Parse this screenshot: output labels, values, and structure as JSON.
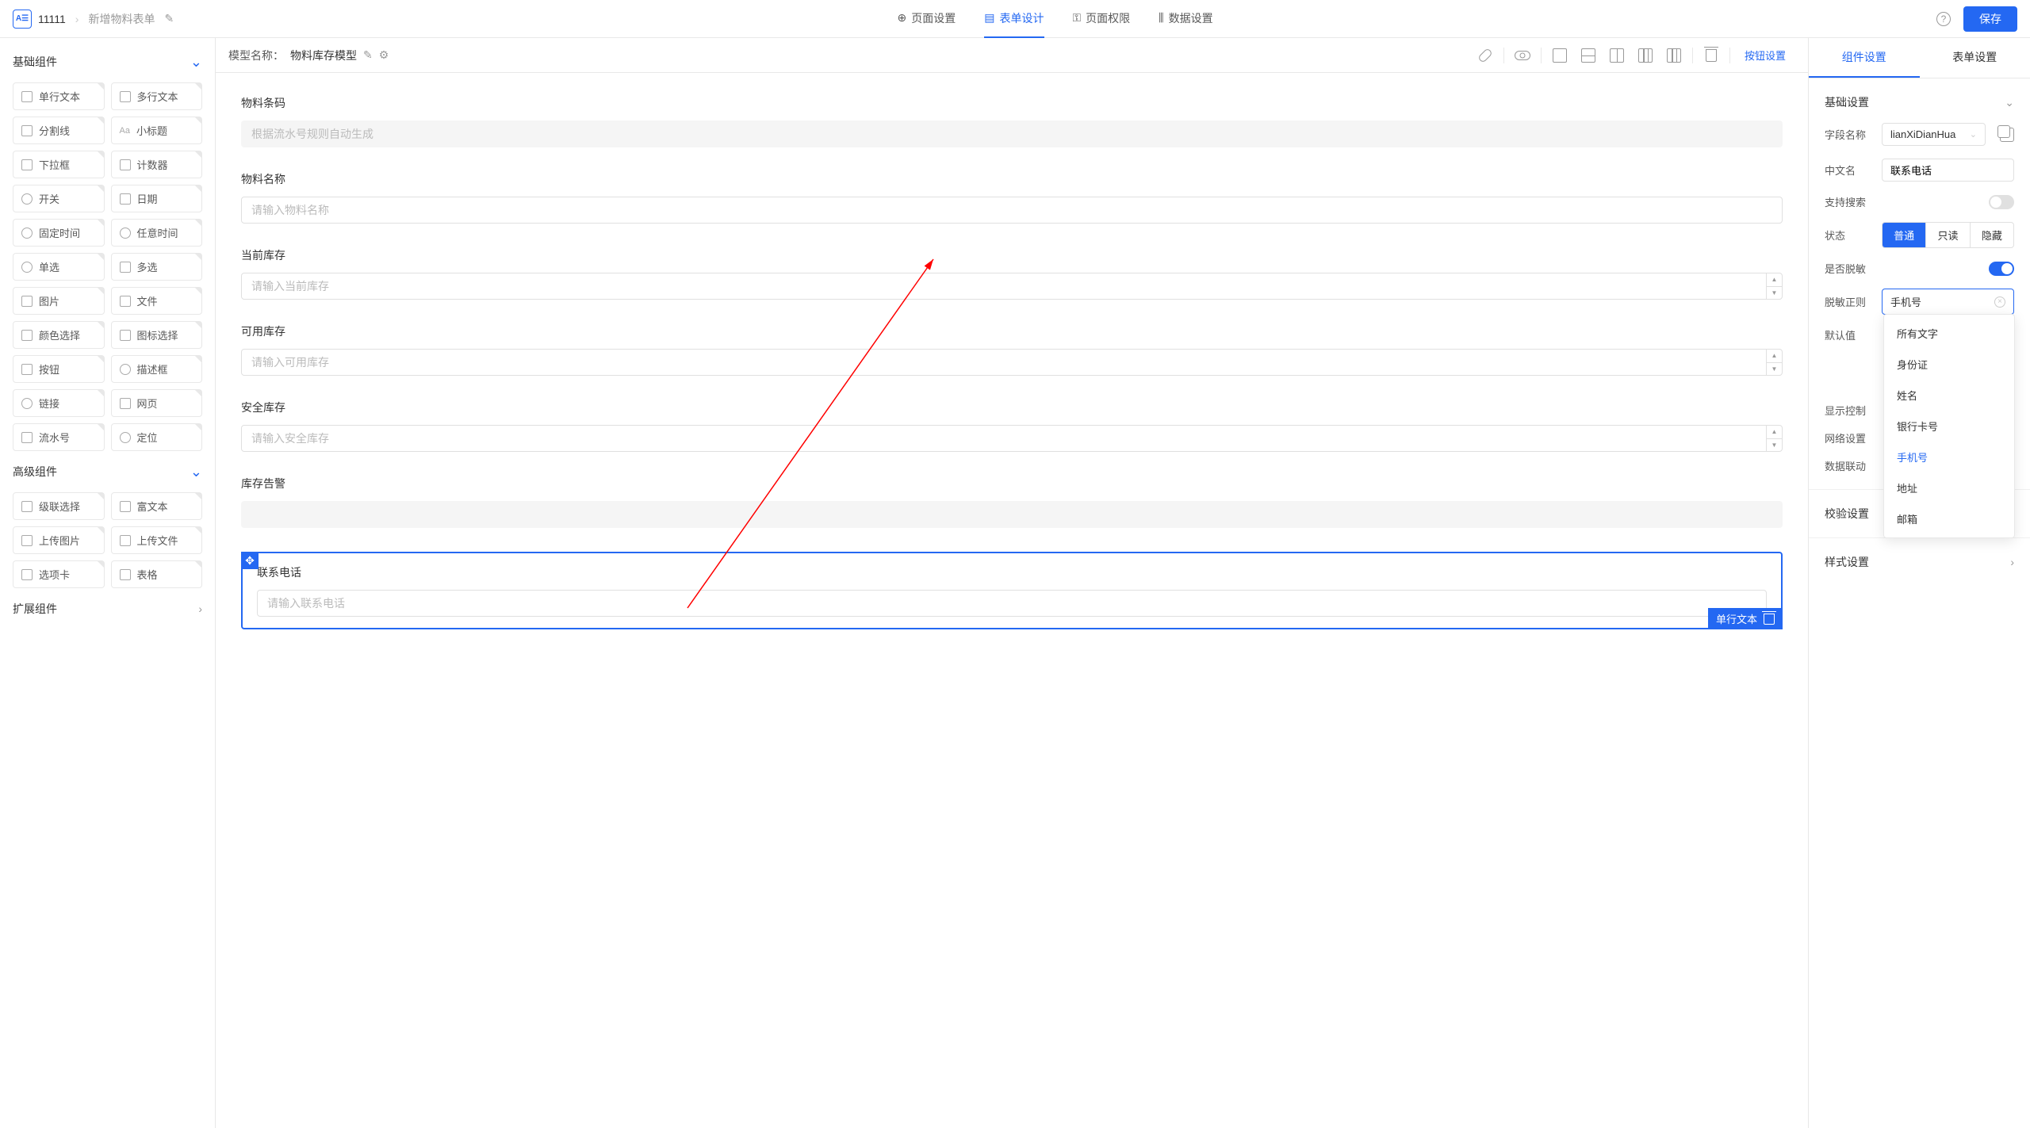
{
  "header": {
    "breadcrumb": {
      "root": "11111",
      "current": "新增物料表单"
    },
    "tabs": [
      {
        "label": "页面设置"
      },
      {
        "label": "表单设计",
        "active": true
      },
      {
        "label": "页面权限"
      },
      {
        "label": "数据设置"
      }
    ],
    "save": "保存"
  },
  "sidebar": {
    "groups": [
      {
        "title": "基础组件",
        "open": true,
        "items": [
          "单行文本",
          "多行文本",
          "分割线",
          "小标题",
          "下拉框",
          "计数器",
          "开关",
          "日期",
          "固定时间",
          "任意时间",
          "单选",
          "多选",
          "图片",
          "文件",
          "颜色选择",
          "图标选择",
          "按钮",
          "描述框",
          "链接",
          "网页",
          "流水号",
          "定位"
        ]
      },
      {
        "title": "高级组件",
        "open": true,
        "items": [
          "级联选择",
          "富文本",
          "上传图片",
          "上传文件",
          "选项卡",
          "表格"
        ]
      },
      {
        "title": "扩展组件",
        "open": false,
        "items": []
      }
    ]
  },
  "canvas": {
    "modelLabel": "模型名称：",
    "modelName": "物料库存模型",
    "buttonSettings": "按钮设置",
    "fields": [
      {
        "label": "物料条码",
        "type": "readonly",
        "placeholder": "根据流水号规则自动生成"
      },
      {
        "label": "物料名称",
        "type": "text",
        "placeholder": "请输入物料名称"
      },
      {
        "label": "当前库存",
        "type": "number",
        "placeholder": "请输入当前库存"
      },
      {
        "label": "可用库存",
        "type": "number",
        "placeholder": "请输入可用库存"
      },
      {
        "label": "安全库存",
        "type": "number",
        "placeholder": "请输入安全库存"
      },
      {
        "label": "库存告警",
        "type": "readonly",
        "placeholder": ""
      },
      {
        "label": "联系电话",
        "type": "text",
        "placeholder": "请输入联系电话",
        "selected": true,
        "tag": "单行文本"
      }
    ]
  },
  "rightPanel": {
    "tabs": {
      "comp": "组件设置",
      "form": "表单设置"
    },
    "section1": "基础设置",
    "props": {
      "fieldNameLabel": "字段名称",
      "fieldNameValue": "lianXiDianHua",
      "cnNameLabel": "中文名",
      "cnNameValue": "联系电话",
      "searchLabel": "支持搜索",
      "statusLabel": "状态",
      "statusOptions": [
        "普通",
        "只读",
        "隐藏"
      ],
      "maskLabel": "是否脱敏",
      "maskRuleLabel": "脱敏正则",
      "maskRuleValue": "手机号",
      "defaultLabel": "默认值",
      "dropdownOptions": [
        "所有文字",
        "身份证",
        "姓名",
        "银行卡号",
        "手机号",
        "地址",
        "邮箱"
      ],
      "displayLabel": "显示控制",
      "networkLabel": "网络设置",
      "linkageLabel": "数据联动"
    },
    "section2": "校验设置",
    "section3": "样式设置"
  }
}
